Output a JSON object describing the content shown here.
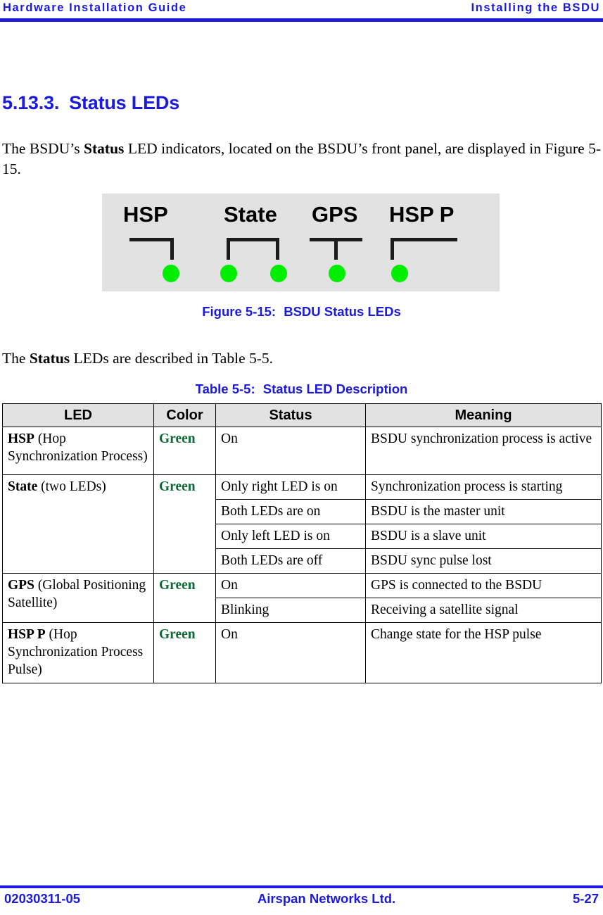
{
  "header": {
    "left": "Hardware Installation Guide",
    "right": "Installing the BSDU",
    "rule_color": "#1a1ae0"
  },
  "heading": {
    "number": "5.13.3.",
    "title": "Status LEDs"
  },
  "paragraphs": {
    "intro_a": "The BSDU’s ",
    "intro_b": "Status",
    "intro_c": " LED indicators, located on the BSDU’s front panel, are displayed in Figure 5-15.",
    "table_ref_a": "The ",
    "table_ref_b": "Status",
    "table_ref_c": " LEDs are described in Table 5-5."
  },
  "figure": {
    "panel_color": "#e2e2e2",
    "led_color": "#00ee00",
    "labels": [
      {
        "text": "HSP",
        "led_count": 1
      },
      {
        "text": "State",
        "led_count": 2
      },
      {
        "text": "GPS",
        "led_count": 1
      },
      {
        "text": "HSP P",
        "led_count": 1
      }
    ],
    "caption_label": "Figure 5-15:",
    "caption_text": "BSDU Status LEDs"
  },
  "table": {
    "caption_label": "Table 5-5:",
    "caption_text": "Status LED Description",
    "columns": [
      "LED",
      "Color",
      "Status",
      "Meaning"
    ],
    "color_value": "Green",
    "color_hex": "#0a6b34",
    "rows": [
      {
        "led_bold": "HSP",
        "led_rest": " (Hop Synchronization Process)",
        "color": "Green",
        "entries": [
          {
            "status": "On",
            "meaning": "BSDU synchronization process is active"
          }
        ]
      },
      {
        "led_bold": "State",
        "led_rest": " (two LEDs)",
        "color": "Green",
        "entries": [
          {
            "status": "Only right LED is on",
            "meaning": "Synchronization process is starting"
          },
          {
            "status": "Both LEDs are on",
            "meaning": "BSDU is the master unit"
          },
          {
            "status": "Only left LED is on",
            "meaning": "BSDU is a slave unit"
          },
          {
            "status": "Both LEDs are off",
            "meaning": "BSDU sync pulse lost"
          }
        ]
      },
      {
        "led_bold": "GPS",
        "led_rest": " (Global Positioning Satellite)",
        "color": "Green",
        "entries": [
          {
            "status": "On",
            "meaning": "GPS is connected to the BSDU"
          },
          {
            "status": "Blinking",
            "meaning": "Receiving a satellite signal"
          }
        ]
      },
      {
        "led_bold": "HSP P",
        "led_rest": " (Hop Synchronization Process Pulse)",
        "color": "Green",
        "entries": [
          {
            "status": "On",
            "meaning": "Change state for the HSP pulse"
          }
        ]
      }
    ]
  },
  "footer": {
    "left": "02030311-05",
    "center": "Airspan Networks Ltd.",
    "right": "5-27",
    "rule_color": "#1a1ae0"
  }
}
